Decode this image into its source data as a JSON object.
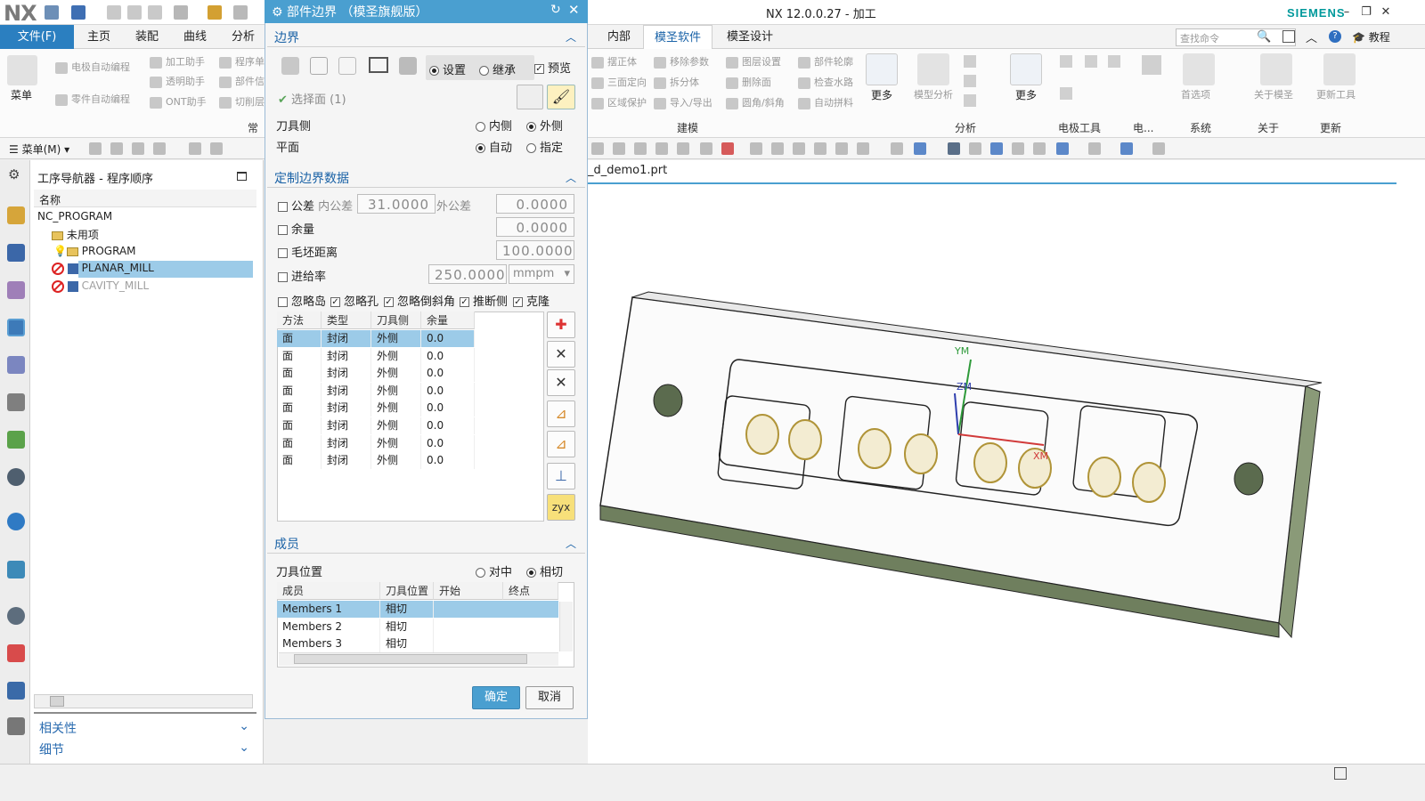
{
  "app": {
    "logo": "NX",
    "title": "NX 12.0.0.27 - 加工",
    "brand": "SIEMENS"
  },
  "menu": {
    "file": "文件(F)",
    "tabs": [
      "主页",
      "装配",
      "曲线",
      "分析"
    ],
    "right_tabs": [
      "内部",
      "模圣软件",
      "模圣设计"
    ],
    "search_placeholder": "查找命令",
    "tutorial": "教程"
  },
  "ribbon": {
    "menu_button": "菜单",
    "left_items": [
      "电极自动编程",
      "零件自动编程",
      "加工助手",
      "透明助手",
      "ONT助手",
      "程序单",
      "部件信",
      "切削层"
    ],
    "left_group": "常",
    "build_items": [
      "摆正体",
      "移除参数",
      "图层设置",
      "部件轮廓",
      "三面定向",
      "拆分体",
      "删除面",
      "检查水路",
      "区域保护",
      "导入/导出",
      "圆角/斜角",
      "自动拼料"
    ],
    "more": "更多",
    "groups": [
      "建模",
      "分析",
      "电极工具",
      "电...",
      "系统",
      "关于",
      "更新"
    ],
    "analysis_items": [
      "模型分析"
    ],
    "system_items": [
      "首选项"
    ],
    "about_items": [
      "关于模圣"
    ],
    "update_items": [
      "更新工具"
    ]
  },
  "toolbar2": {
    "menu": "菜单(M)"
  },
  "navigator": {
    "title": "工序导航器 - 程序顺序",
    "column": "名称",
    "items": [
      "NC_PROGRAM",
      "未用项",
      "PROGRAM",
      "PLANAR_MILL",
      "CAVITY_MILL"
    ],
    "relations": "相关性",
    "details": "细节"
  },
  "dialog": {
    "title": "部件边界 （模圣旗舰版）",
    "boundary": {
      "head": "边界",
      "set": "设置",
      "inherit": "继承",
      "preview": "预览",
      "select_face": "选择面 (1)",
      "tool_side": "刀具侧",
      "inner": "内侧",
      "outer": "外侧",
      "plane": "平面",
      "auto": "自动",
      "specify": "指定"
    },
    "custom": {
      "head": "定制边界数据",
      "tolerance": "公差",
      "in_tol": "内公差",
      "in_tol_value": "31.0000",
      "out_tol": "外公差",
      "out_tol_value": "0.0000",
      "stock": "余量",
      "stock_value": "0.0000",
      "blank_dist": "毛坯距离",
      "blank_value": "100.0000",
      "feed": "进给率",
      "feed_value": "250.0000",
      "feed_unit": "mmpm",
      "opt1": "忽略岛",
      "opt2": "忽略孔",
      "opt3": "忽略倒斜角",
      "opt4": "推断侧",
      "opt5": "克隆",
      "columns": [
        "方法",
        "类型",
        "刀具侧",
        "余量"
      ],
      "rows": [
        [
          "面",
          "封闭",
          "外侧",
          "0.0"
        ],
        [
          "面",
          "封闭",
          "外侧",
          "0.0"
        ],
        [
          "面",
          "封闭",
          "外侧",
          "0.0"
        ],
        [
          "面",
          "封闭",
          "外侧",
          "0.0"
        ],
        [
          "面",
          "封闭",
          "外侧",
          "0.0"
        ],
        [
          "面",
          "封闭",
          "外侧",
          "0.0"
        ],
        [
          "面",
          "封闭",
          "外侧",
          "0.0"
        ],
        [
          "面",
          "封闭",
          "外侧",
          "0.0"
        ]
      ]
    },
    "members": {
      "head": "成员",
      "tool_pos": "刀具位置",
      "on": "对中",
      "tangent": "相切",
      "columns": [
        "成员",
        "刀具位置",
        "开始",
        "终点"
      ],
      "rows": [
        [
          "Members 1",
          "相切"
        ],
        [
          "Members 2",
          "相切"
        ],
        [
          "Members 3",
          "相切"
        ]
      ]
    },
    "ok": "确定",
    "cancel": "取消"
  },
  "viewport": {
    "file": "_d_demo1.prt",
    "axis": {
      "ym": "YM",
      "zm": "ZM",
      "xm": "XM"
    }
  },
  "colors": {
    "accent": "#4a9fd0",
    "file_tab": "#2b7fc0",
    "part": "#2c2c2c",
    "part_side": "#6f7f5e",
    "hole": "#c8b25c"
  }
}
